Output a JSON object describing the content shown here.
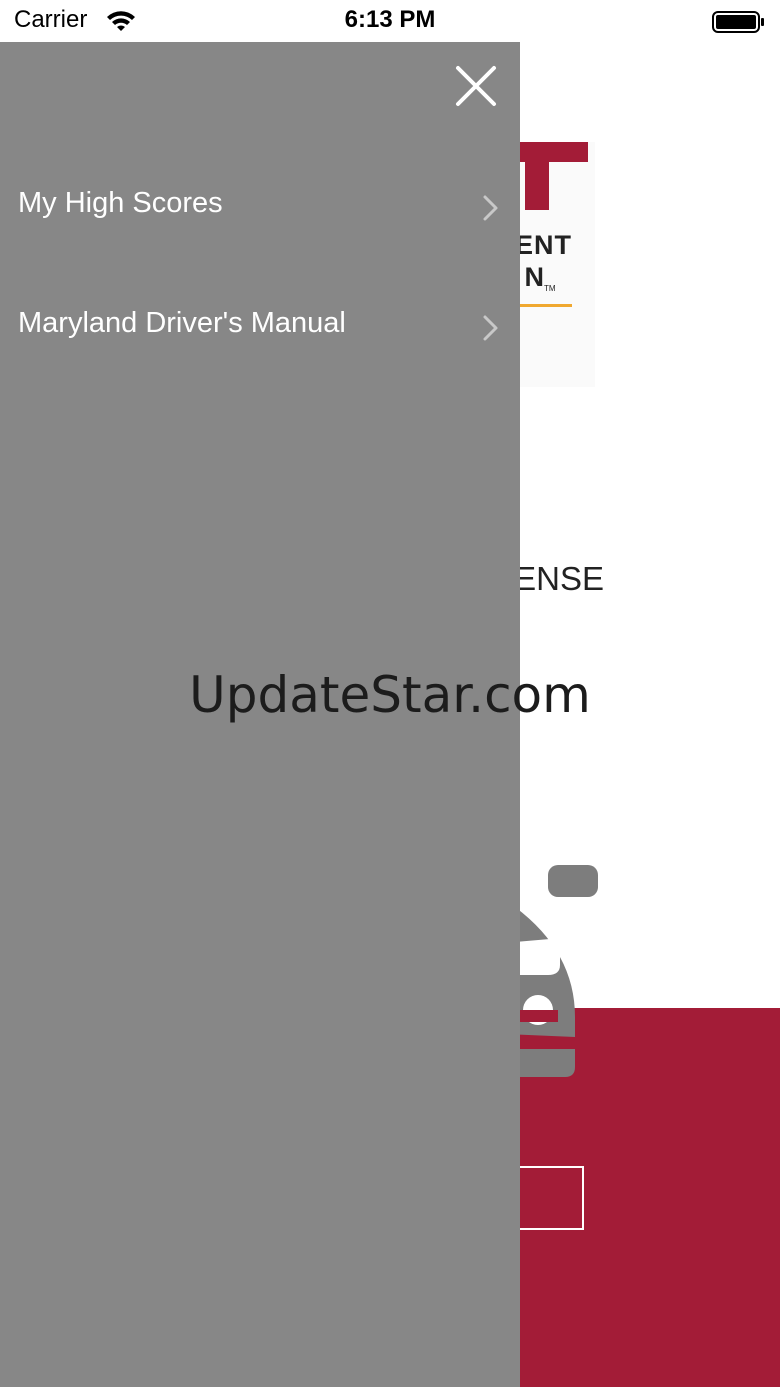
{
  "status_bar": {
    "carrier": "Carrier",
    "time": "6:13 PM",
    "wifi_icon": "wifi-icon",
    "battery_icon": "battery-full-icon"
  },
  "background": {
    "logo": {
      "line1": "ENT",
      "line2": "N",
      "tm": "TM",
      "brand_color": "#a31c37",
      "accent_color": "#f0a830"
    },
    "license_text": "ENSE",
    "car_icon": "car-icon",
    "panel_color": "#a31c37"
  },
  "drawer": {
    "background_color": "#878787",
    "close_icon": "close-icon",
    "items": [
      {
        "label": "My High Scores",
        "icon": "chevron-right-icon"
      },
      {
        "label": "Maryland Driver's Manual",
        "icon": "chevron-right-icon"
      }
    ]
  },
  "watermark": {
    "text": "UpdateStar.com"
  }
}
